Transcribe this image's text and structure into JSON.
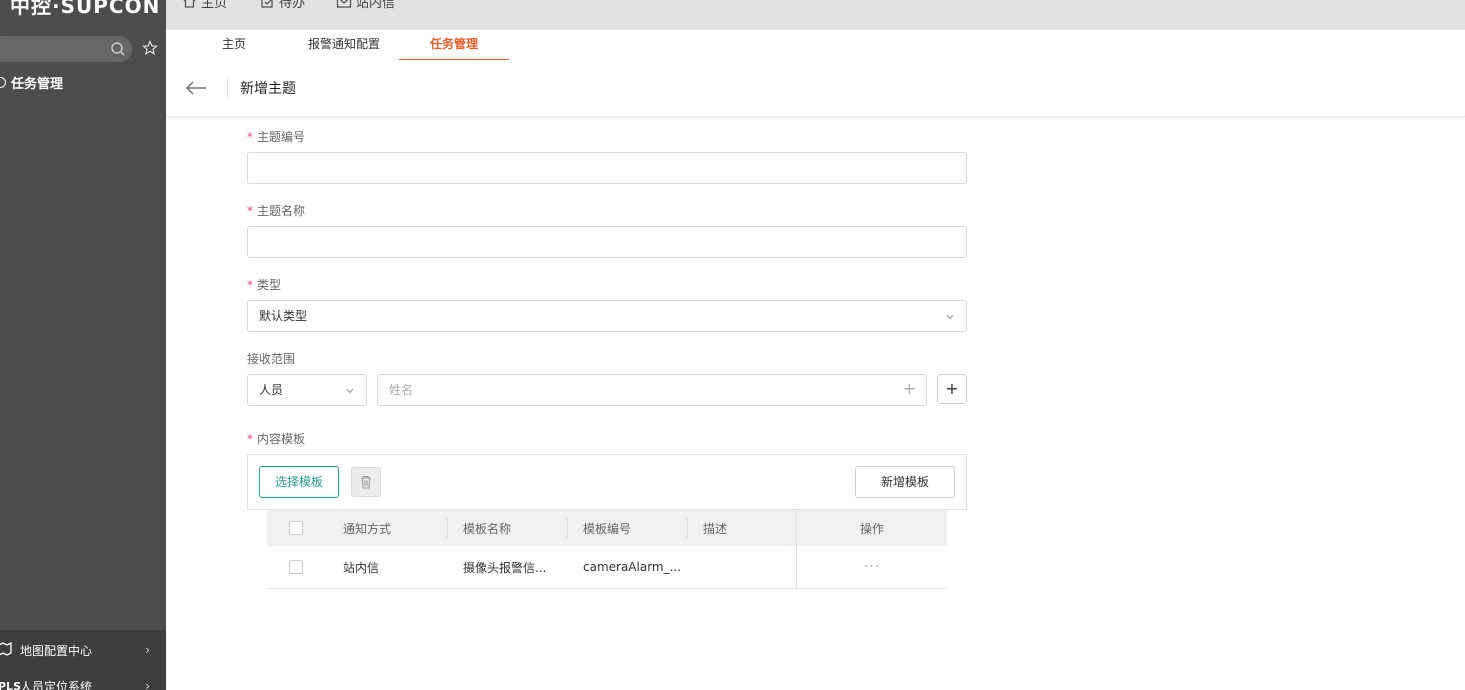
{
  "app": {
    "logo": "中控·SUPCON"
  },
  "topnav": [
    {
      "label": "主页",
      "icon": "home-icon"
    },
    {
      "label": "待办",
      "icon": "todo-icon"
    },
    {
      "label": "站内信",
      "icon": "mail-icon"
    }
  ],
  "sidebar": {
    "active_item": "任务管理",
    "bottom_items": [
      {
        "label": "地图配置中心",
        "icon": "map-icon"
      },
      {
        "label": "人员定位系统",
        "icon": "pls-icon",
        "icon_text": "PLS"
      }
    ]
  },
  "tabs": [
    {
      "label": "主页"
    },
    {
      "label": "报警通知配置"
    },
    {
      "label": "任务管理",
      "active": true
    }
  ],
  "page": {
    "title": "新增主题"
  },
  "form": {
    "required_mark": "*",
    "topic_code": {
      "label": "主题编号",
      "value": ""
    },
    "topic_name": {
      "label": "主题名称",
      "value": ""
    },
    "type": {
      "label": "类型",
      "value": "默认类型"
    },
    "scope": {
      "label": "接收范围",
      "kind": "人员",
      "placeholder": "姓名",
      "plus": "+"
    },
    "template": {
      "label": "内容模板",
      "select_button": "选择模板",
      "new_button": "新增模板"
    }
  },
  "table": {
    "headers": [
      "通知方式",
      "模板名称",
      "模板编号",
      "描述",
      "操作"
    ],
    "rows": [
      {
        "method": "站内信",
        "name": "摄像头报警信...",
        "code": "cameraAlarm_...",
        "desc": "",
        "action": "···"
      }
    ]
  },
  "colors": {
    "accent": "#e8612c",
    "primary_green": "#2a9d8f",
    "required": "#e0467c",
    "sidebar": "#4d4d4d"
  }
}
